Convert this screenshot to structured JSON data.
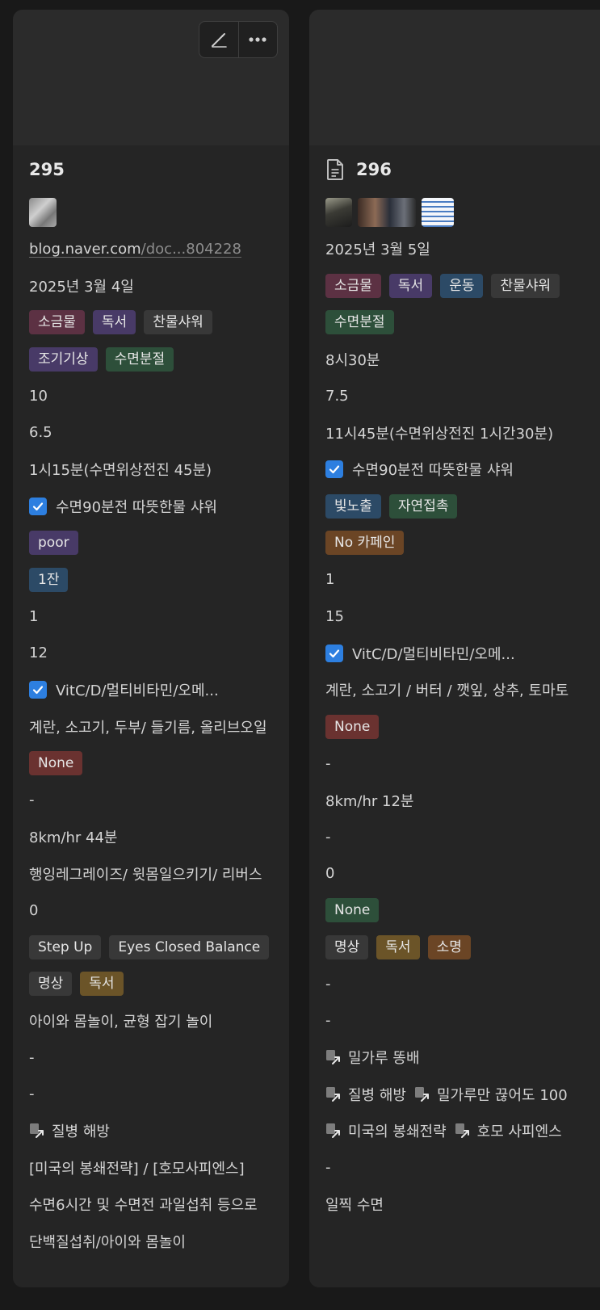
{
  "card1": {
    "title": "295",
    "url_main": "blog.naver.com",
    "url_muted": "/doc...804228",
    "date": "2025년 3월 4일",
    "tags_a": [
      "소금물",
      "독서",
      "찬물샤워"
    ],
    "tags_b": [
      "조기기상",
      "수면분절"
    ],
    "v10": "10",
    "v65": "6.5",
    "duration": "1시15분(수면위상전진 45분)",
    "check1": "수면90분전 따뜻한물 샤워",
    "sleep_quality": "poor",
    "cups": "1잔",
    "v1": "1",
    "v12": "12",
    "check2": "VitC/D/멀티비타민/오메...",
    "food": "계란, 소고기, 두부/ 들기름, 올리브오일",
    "none_tag": "None",
    "dash1": "-",
    "run": "8km/hr 44분",
    "exercise": "행잉레그레이즈/ 윗몸일으키기/ 리버스",
    "v0": "0",
    "balance_tags": [
      "Step Up",
      "Eyes Closed Balance"
    ],
    "mind_tags": [
      "명상",
      "독서"
    ],
    "play": "아이와 몸놀이, 균형 잡기 놀이",
    "dash2": "-",
    "dash3": "-",
    "link1": "질병 해방",
    "books": "[미국의 봉쇄전략] / [호모사피엔스]",
    "note": "수면6시간 및 수면전 과일섭취 등으로",
    "last": "단백질섭취/아이와 몸놀이"
  },
  "card2": {
    "title": "296",
    "date": "2025년 3월 5일",
    "tags_a": [
      "소금물",
      "독서",
      "운동",
      "찬물샤워"
    ],
    "tags_b": [
      "수면분절"
    ],
    "sleep_time": "8시30분",
    "v75": "7.5",
    "duration": "11시45분(수면위상전진 1시간30분)",
    "check1": "수면90분전 따뜻한물 샤워",
    "light_tags": [
      "빛노출",
      "자연접촉"
    ],
    "caffeine_tag": "No 카페인",
    "v1": "1",
    "v15": "15",
    "check2": "VitC/D/멀티비타민/오메...",
    "food": "계란, 소고기 / 버터 / 깻잎, 상추, 토마토",
    "none_tag": "None",
    "dash1": "-",
    "run": "8km/hr 12분",
    "dash2": "-",
    "v0": "0",
    "none_tag2": "None",
    "mind_tags": [
      "명상",
      "독서",
      "소명"
    ],
    "dash3": "-",
    "dash4": "-",
    "link1": "밀가루 똥배",
    "link2a": "질병 해방",
    "link2b": "밀가루만 끊어도 100",
    "link3a": "미국의 봉쇄전략",
    "link3b": "호모 사피엔스",
    "dash5": "-",
    "last": "일찍 수면"
  },
  "colors": {
    "background": "#191919",
    "card": "#252525",
    "checkbox": "#2d7fe0"
  },
  "icons": [
    "edit-icon",
    "more-icon",
    "document-icon",
    "checkbox-icon",
    "page-link-icon"
  ]
}
